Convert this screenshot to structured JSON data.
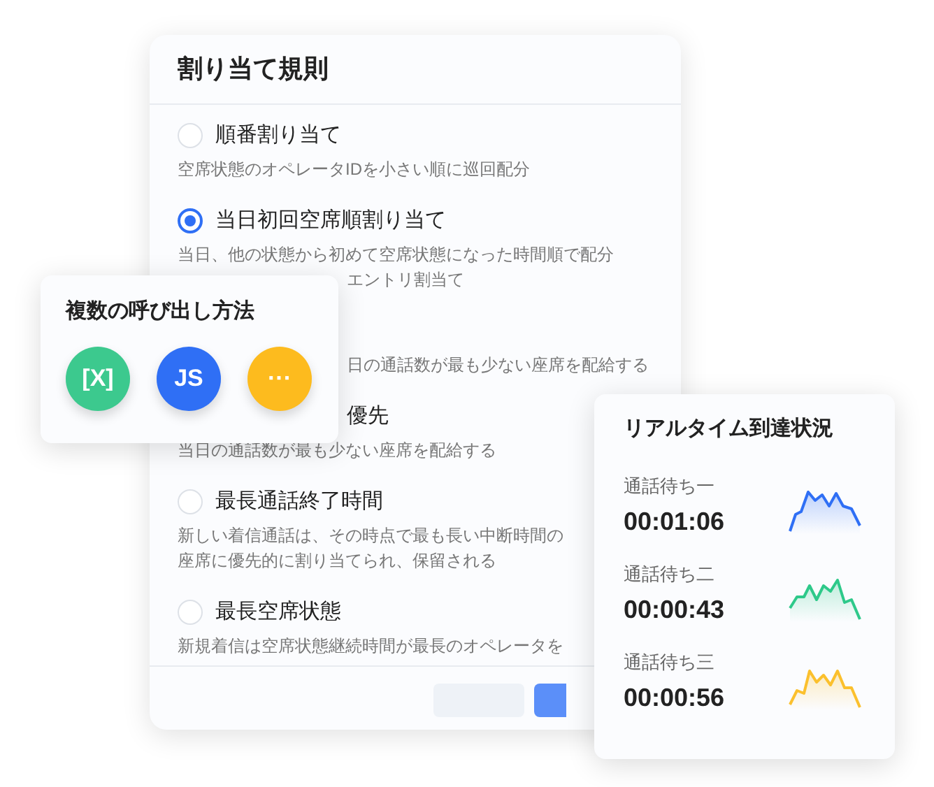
{
  "rules_panel": {
    "title": "割り当て規則",
    "items": [
      {
        "title": "順番割り当て",
        "selected": false,
        "lines": [
          {
            "text": "空席状態のオペレータIDを小さい順に巡回配分",
            "covered": false
          }
        ]
      },
      {
        "title": "当日初回空席順割り当て",
        "selected": true,
        "lines": [
          {
            "text": "当日、他の状態から初めて空席状態になった時間順で配分",
            "covered": false
          },
          {
            "text": "エントリ割当て",
            "covered": true
          }
        ]
      },
      {
        "lines": [
          {
            "text": "日の通話数が最も少ない座席を配給する",
            "covered": true
          }
        ]
      },
      {
        "title": "優先",
        "lines": [
          {
            "text": "当日の通話数が最も少ない座席を配給する",
            "covered": false
          }
        ]
      },
      {
        "title": "最長通話終了時間",
        "selected": false,
        "lines": [
          {
            "text": "新しい着信通話は、その時点で最も長い中断時間の",
            "covered": false
          },
          {
            "text": "座席に優先的に割り当てられ、保留される",
            "covered": false
          }
        ]
      },
      {
        "title": "最長空席状態",
        "selected": false,
        "lines": [
          {
            "text": "新規着信は空席状態継続時間が最長のオペレータを",
            "covered": false
          }
        ]
      }
    ]
  },
  "call_methods": {
    "title": "複数の呼び出し方法",
    "methods": [
      {
        "label": "[X]",
        "color": "#3cc98e"
      },
      {
        "label": "JS",
        "color": "#2f6ff5"
      },
      {
        "label": "···",
        "color": "#fdbb1e"
      }
    ]
  },
  "realtime": {
    "title": "リアルタイム到達状況",
    "rows": [
      {
        "label": "通話待ち一",
        "time": "00:01:06",
        "color": "#2f6ff5"
      },
      {
        "label": "通話待ち二",
        "time": "00:00:43",
        "color": "#2ec98a"
      },
      {
        "label": "通話待ち三",
        "time": "00:00:56",
        "color": "#fbc02d"
      }
    ]
  }
}
